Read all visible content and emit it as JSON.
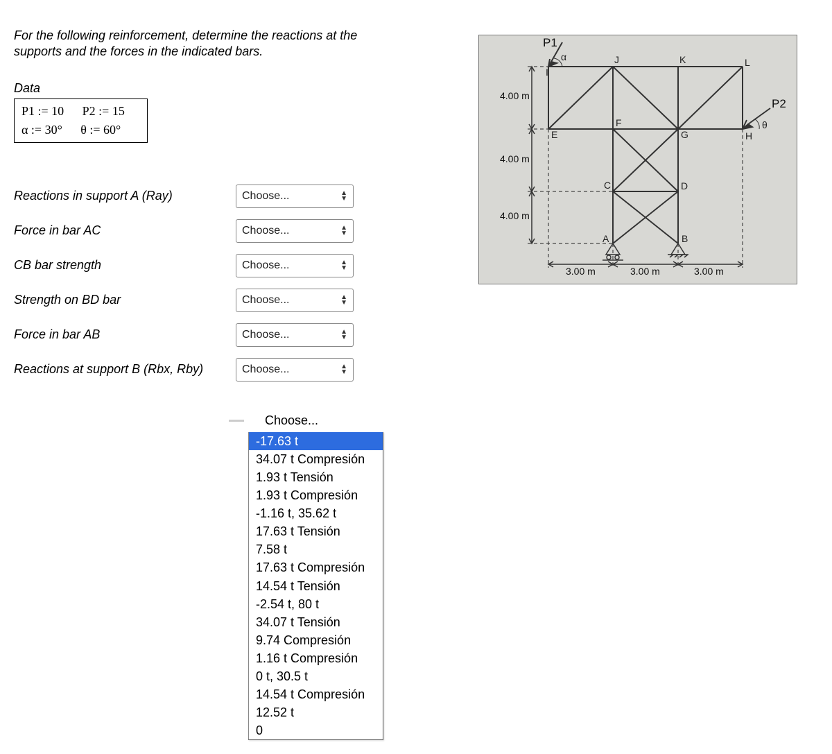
{
  "problem": {
    "text_line1": "For the following reinforcement, determine the reactions at the",
    "text_line2": "supports and the forces in the indicated bars."
  },
  "data": {
    "heading": "Data",
    "p1": "P1 := 10",
    "p2": "P2 := 15",
    "alpha": "α := 30°",
    "theta": "θ := 60°"
  },
  "questions": [
    {
      "label": "Reactions in support A (Ray)",
      "placeholder": "Choose..."
    },
    {
      "label": "Force in bar AC",
      "placeholder": "Choose..."
    },
    {
      "label": "CB bar strength",
      "placeholder": "Choose..."
    },
    {
      "label": "Strength on BD bar",
      "placeholder": "Choose..."
    },
    {
      "label": "Force in bar AB",
      "placeholder": "Choose..."
    },
    {
      "label": "Reactions at support B (Rbx, Rby)",
      "placeholder": "Choose..."
    }
  ],
  "dropdown_open": {
    "top_label": "Choose...",
    "highlighted": "-17.63 t",
    "options": [
      "34.07 t Compresión",
      "1.93 t Tensión",
      "1.93 t Compresión",
      "-1.16 t, 35.62 t",
      "17.63 t Tensión",
      "7.58 t",
      "17.63 t Compresión",
      "14.54 t Tensión",
      "-2.54 t, 80 t",
      "34.07 t Tensión",
      "9.74 Compresión",
      "1.16 t Compresión",
      "0 t, 30.5 t",
      "14.54 t Compresión",
      "12.52 t",
      "0"
    ]
  },
  "diagram": {
    "load_p1": "P1",
    "load_p2": "P2",
    "angle_alpha": "α",
    "angle_theta": "θ",
    "dim_v": "4.00 m",
    "dim_h": "3.00 m",
    "nodes": {
      "A": "A",
      "B": "B",
      "C": "C",
      "D": "D",
      "E": "E",
      "F": "F",
      "G": "G",
      "H": "H",
      "I": "I",
      "J": "J",
      "K": "K",
      "L": "L"
    }
  }
}
